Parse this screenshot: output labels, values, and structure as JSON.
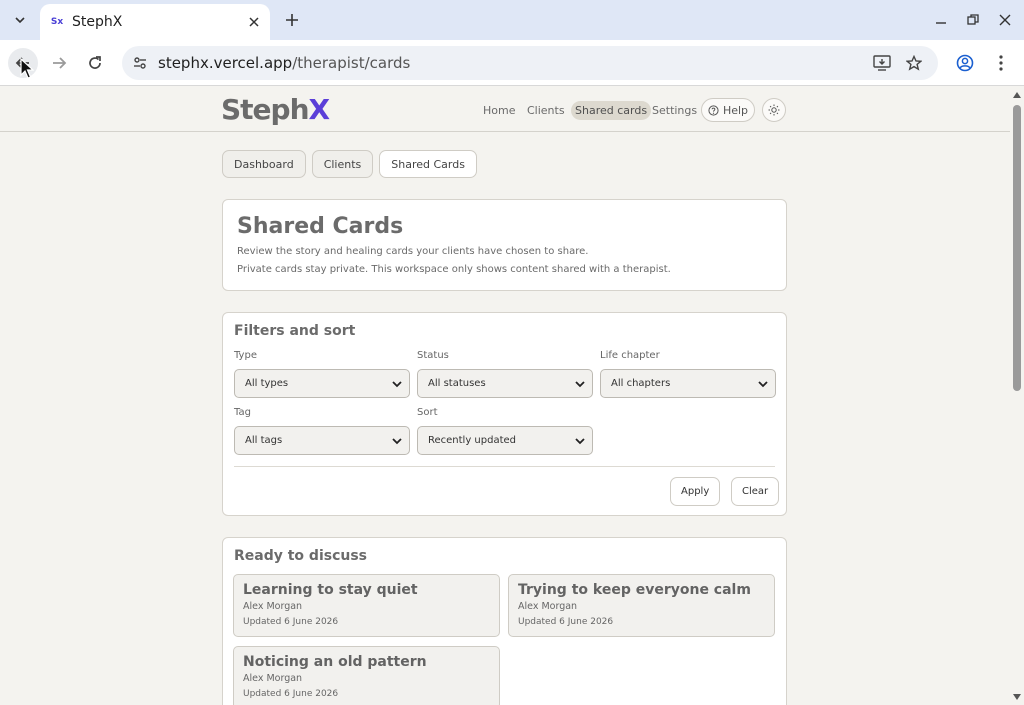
{
  "browser": {
    "tab_title": "StephX",
    "favicon_text": "Sx",
    "url_host": "stephx.vercel.app",
    "url_path": "/therapist/cards"
  },
  "header": {
    "logo_main": "Steph",
    "logo_accent": "X",
    "nav": [
      {
        "label": "Home",
        "active": false
      },
      {
        "label": "Clients",
        "active": false
      },
      {
        "label": "Shared cards",
        "active": true
      },
      {
        "label": "Settings",
        "active": false
      }
    ],
    "help_label": "Help"
  },
  "subnav": [
    {
      "label": "Dashboard",
      "active": false
    },
    {
      "label": "Clients",
      "active": false
    },
    {
      "label": "Shared Cards",
      "active": true
    }
  ],
  "intro": {
    "title": "Shared Cards",
    "line1": "Review the story and healing cards your clients have chosen to share.",
    "line2": "Private cards stay private. This workspace only shows content shared with a therapist."
  },
  "filters": {
    "title": "Filters and sort",
    "fields": [
      {
        "label": "Type",
        "value": "All types"
      },
      {
        "label": "Status",
        "value": "All statuses"
      },
      {
        "label": "Life chapter",
        "value": "All chapters"
      },
      {
        "label": "Tag",
        "value": "All tags"
      },
      {
        "label": "Sort",
        "value": "Recently updated"
      }
    ],
    "apply_label": "Apply",
    "clear_label": "Clear"
  },
  "discuss": {
    "title": "Ready to discuss",
    "cards": [
      {
        "title": "Learning to stay quiet",
        "client": "Alex Morgan",
        "updated": "Updated 6 June 2026"
      },
      {
        "title": "Trying to keep everyone calm",
        "client": "Alex Morgan",
        "updated": "Updated 6 June 2026"
      },
      {
        "title": "Noticing an old pattern",
        "client": "Alex Morgan",
        "updated": "Updated 6 June 2026"
      }
    ]
  },
  "colors": {
    "accent": "#5b3fd8",
    "page_bg": "#f4f3ef",
    "active_nav_bg": "#ddd9cf"
  }
}
